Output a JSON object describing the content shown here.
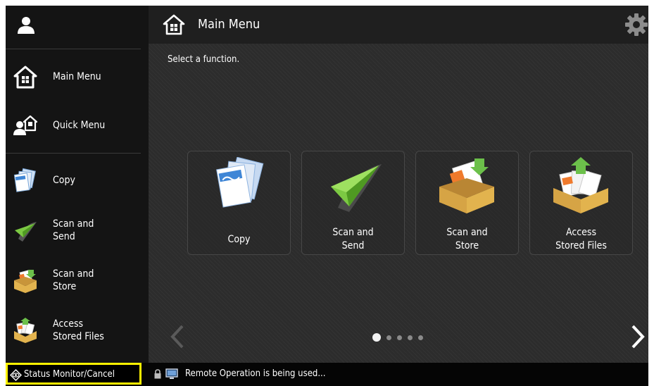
{
  "sidebar": {
    "items": [
      {
        "label": "Main Menu",
        "icon": "home-icon"
      },
      {
        "label": "Quick Menu",
        "icon": "quick-menu-icon"
      },
      {
        "label": "Copy",
        "icon": "copy-icon"
      },
      {
        "label": "Scan and\nSend",
        "icon": "paper-plane-icon"
      },
      {
        "label": "Scan and\nStore",
        "icon": "box-store-icon"
      },
      {
        "label": "Access\nStored Files",
        "icon": "stored-files-icon"
      }
    ]
  },
  "header": {
    "title": "Main Menu"
  },
  "prompt": "Select a function.",
  "tiles": [
    {
      "label": "Copy",
      "icon": "copy-icon"
    },
    {
      "label": "Scan and\nSend",
      "icon": "paper-plane-icon"
    },
    {
      "label": "Scan and\nStore",
      "icon": "box-store-icon"
    },
    {
      "label": "Access\nStored Files",
      "icon": "stored-files-icon"
    }
  ],
  "pager": {
    "pages": 5,
    "current": 1
  },
  "status": {
    "button_label": "Status Monitor/Cancel",
    "message": "Remote Operation is being used..."
  },
  "colors": {
    "highlight": "#fff200",
    "plane": "#7cc943",
    "box": "#e2b34e",
    "doc": "#3f86d6"
  }
}
